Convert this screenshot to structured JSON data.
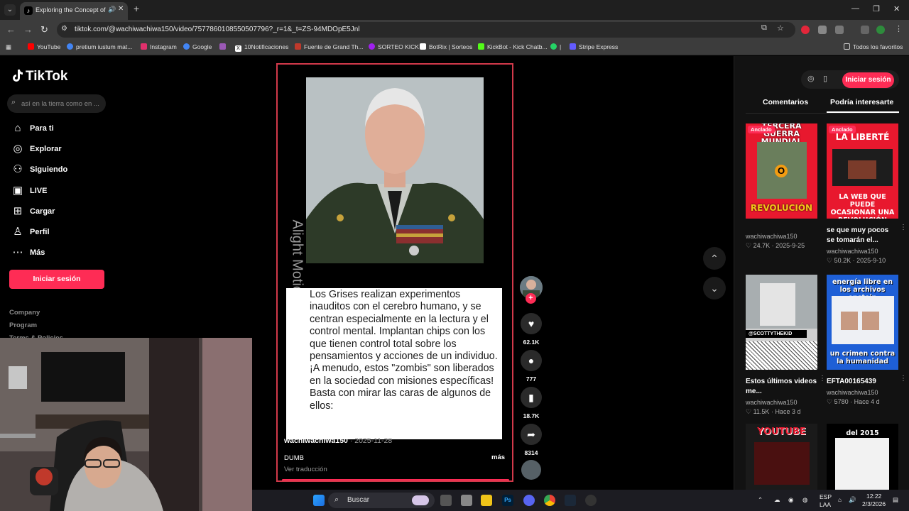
{
  "browser": {
    "tab_title": "Exploring the Concept of H",
    "url_main": "tiktok.com/@wachiwachiwa150/video/7577860108550507796?_r=1&_t=ZS-94MDOpE5Jnl",
    "bookmarks": [
      {
        "label": "YouTube",
        "color": "#ff0000"
      },
      {
        "label": "pretium iustum mat...",
        "color": "#4285f4"
      },
      {
        "label": "Instagram",
        "color": "#e1306c"
      },
      {
        "label": "Google",
        "color": "#4285f4"
      },
      {
        "label": "",
        "color": "#9b59b6"
      },
      {
        "label": "10Notificaciones",
        "color": "#000000"
      },
      {
        "label": "Fuente de Grand Th...",
        "color": "#c0392b"
      },
      {
        "label": "SORTEO KICK",
        "color": "#a020f0"
      },
      {
        "label": "BotRix | Sorteos",
        "color": "#ffffff"
      },
      {
        "label": "KickBot - Kick Chatb...",
        "color": "#53fc18"
      },
      {
        "label": "|",
        "color": "#25d366"
      },
      {
        "label": "Stripe Express",
        "color": "#635bff"
      }
    ],
    "all_favorites": "Todos los favoritos"
  },
  "tiktok": {
    "logo": "TikTok",
    "search_placeholder": "así en la tierra como en ...",
    "nav": [
      {
        "label": "Para ti",
        "icon": "home-icon"
      },
      {
        "label": "Explorar",
        "icon": "compass-icon"
      },
      {
        "label": "Siguiendo",
        "icon": "following-icon"
      },
      {
        "label": "LIVE",
        "icon": "live-icon"
      },
      {
        "label": "Cargar",
        "icon": "upload-icon"
      },
      {
        "label": "Perfil",
        "icon": "profile-icon"
      },
      {
        "label": "Más",
        "icon": "more-icon"
      }
    ],
    "login_button": "Iniciar sesión",
    "footer": [
      "Company",
      "Program",
      "Terms & Policies"
    ],
    "video": {
      "watermark": "Alight Motion",
      "caption": "Los Grises realizan experimentos inauditos con el cerebro humano, y se centran especialmente en la lectura y el control mental. Implantan chips con los que tienen control total sobre los pensamientos y acciones de un individuo. ¡A menudo, estos \"zombis\" son liberados en la sociedad con misiones específicas! Basta con mirar las caras de algunos de ellos:",
      "username": "wachiwachiwa150",
      "date": "· 2025-11-28",
      "description": "DUMB",
      "more": "más",
      "translate": "Ver traducción",
      "likes": "62.1K",
      "comments": "777",
      "saves": "18.7K",
      "shares": "8314"
    },
    "right_panel": {
      "login": "Iniciar sesión",
      "tab_comments": "Comentarios",
      "tab_suggested": "Podría interesarte",
      "pinned": "Anclado",
      "videos": [
        {
          "thumb_top": "TERCERA GUERRA MUNDIAL",
          "thumb_bottom": "REVOLUCIÓN",
          "title": "",
          "author": "wachiwachiwa150",
          "likes": "24.7K",
          "date": "2025-9-25"
        },
        {
          "thumb_top": "LA LIBERTÉ",
          "thumb_bottom": "LA WEB QUE PUEDE OCASIONAR UNA REVOLUCIÓN",
          "title": "se que muy pocos se tomarán el...",
          "author": "wachiwachiwa150",
          "likes": "50.2K",
          "date": "2025-9-10"
        },
        {
          "thumb_top": "@SCOTTYTHEKID",
          "thumb_bottom": "",
          "title": "Estos últimos videos me...",
          "author": "wachiwachiwa150",
          "likes": "11.5K",
          "date": "Hace 3 d"
        },
        {
          "thumb_top": "energía libre en los archivos epstein",
          "thumb_bottom": "un crimen contra la humanidad",
          "title": "EFTA00165439",
          "author": "wachiwachiwa150",
          "likes": "5780",
          "date": "Hace 4 d"
        },
        {
          "thumb_top": "YOUTUBE",
          "thumb_bottom": "",
          "title": "",
          "author": "",
          "likes": "",
          "date": ""
        },
        {
          "thumb_top": "del 2015",
          "thumb_bottom": "",
          "title": "",
          "author": "",
          "likes": "",
          "date": ""
        }
      ]
    }
  },
  "taskbar": {
    "search": "Buscar",
    "lang": "ESP",
    "region": "LAA",
    "time": "12:22",
    "date": "2/3/2026"
  },
  "colors": {
    "accent": "#fe2c55",
    "frame": "#d2394a"
  }
}
